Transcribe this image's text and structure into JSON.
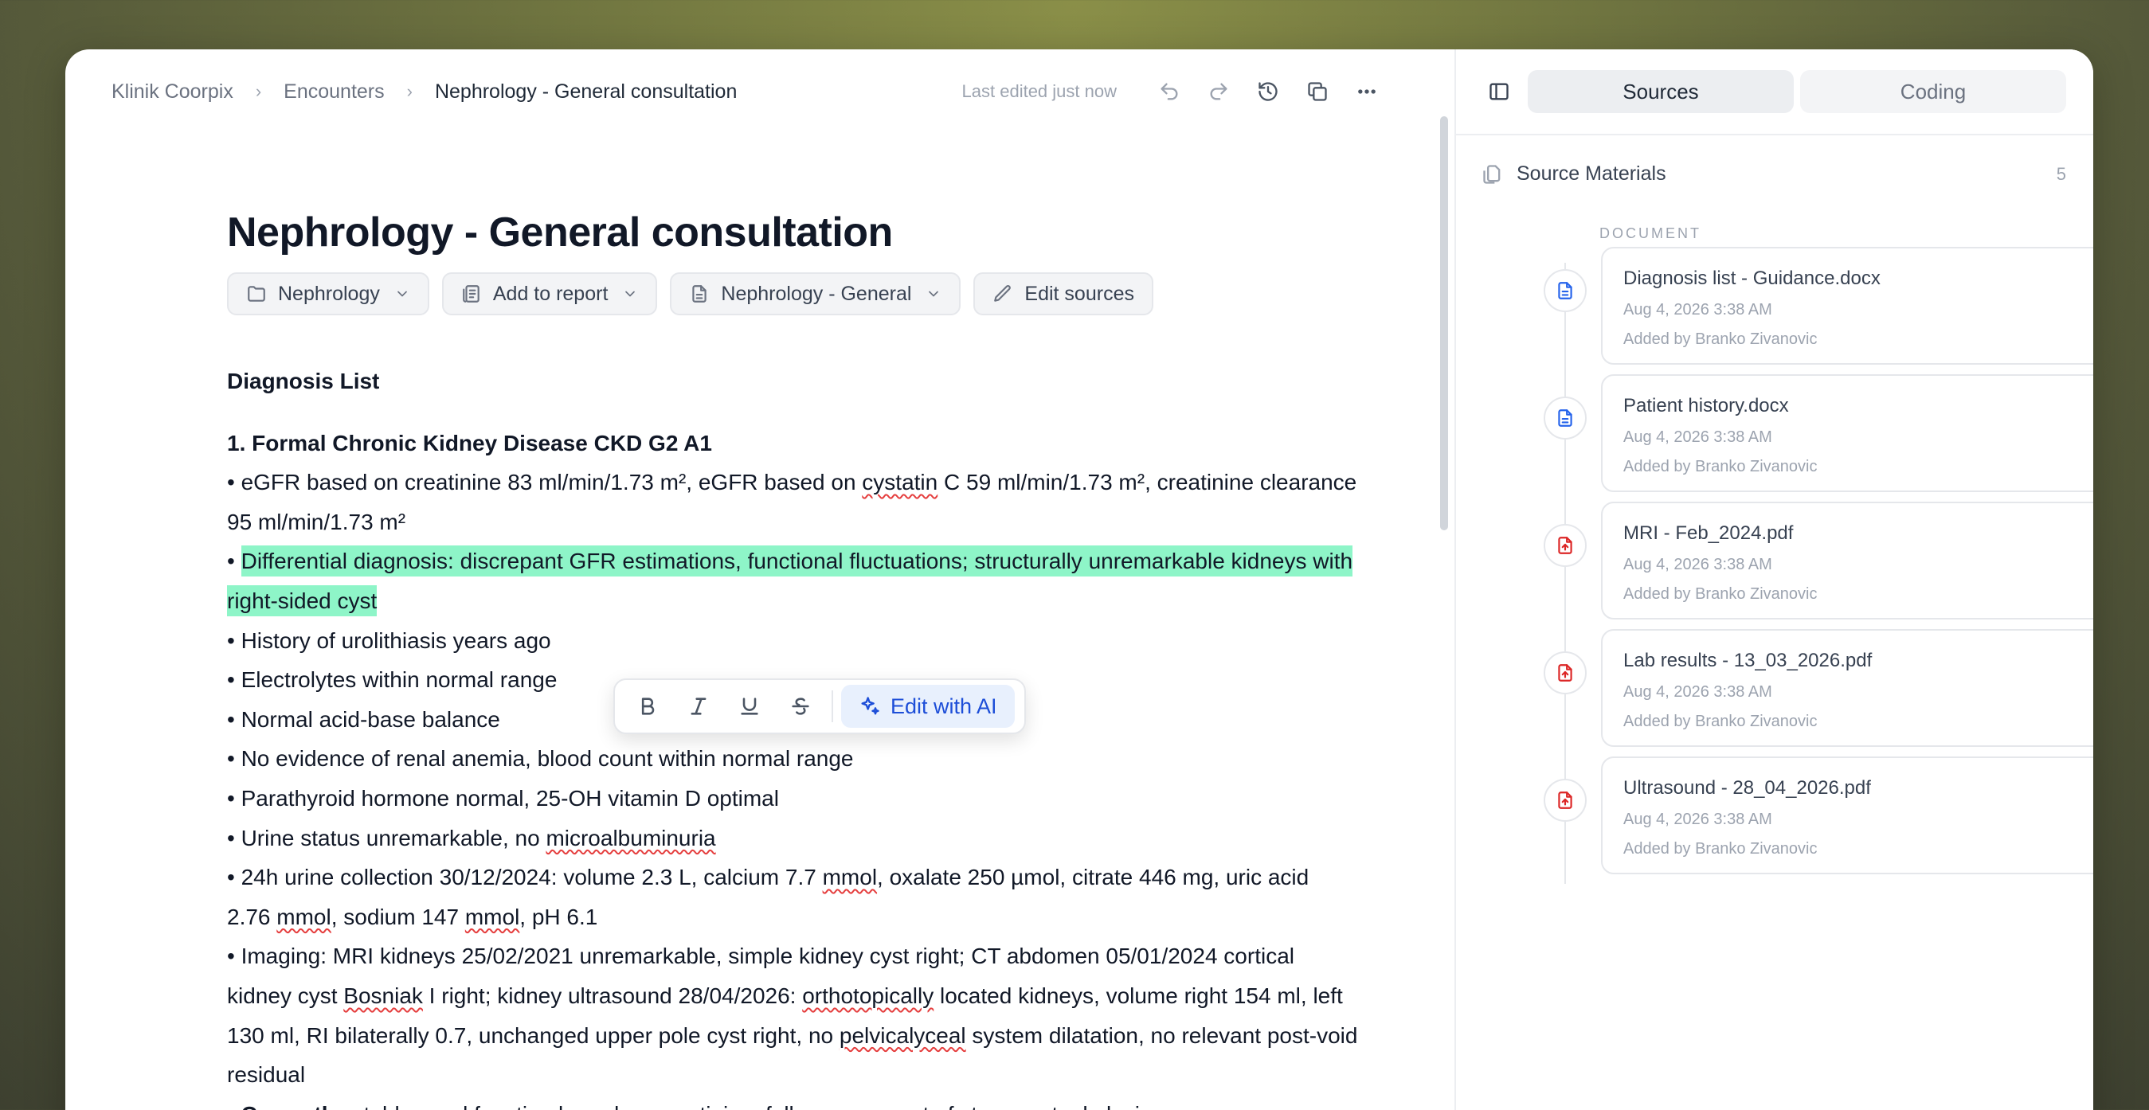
{
  "breadcrumb": [
    "Klinik Coorpix",
    "Encounters",
    "Nephrology - General consultation"
  ],
  "status": {
    "last_edited": "Last edited just now"
  },
  "document": {
    "title": "Nephrology - General consultation",
    "chips": [
      {
        "label": "Nephrology",
        "icon": "folder-icon"
      },
      {
        "label": "Add to report",
        "icon": "report-icon"
      },
      {
        "label": "Nephrology - General",
        "icon": "template-icon"
      },
      {
        "label": "Edit sources",
        "icon": "pencil-icon"
      }
    ],
    "section_title": "Diagnosis List",
    "item_title": "1. Formal Chronic Kidney Disease CKD G2 A1",
    "lines": {
      "l1a": "• eGFR based on creatinine 83 ml/min/1.73 m², eGFR based on ",
      "l1b": "cystatin",
      "l1c": " C 59 ml/min/1.73 m², creatinine clearance 95 ml/min/1.73 m²",
      "l2a": "• ",
      "l2b": "Differential diagnosis: discrepant GFR estimations, functional fluctuations; structurally unremarkable kidneys with right-sided cyst",
      "l3": "• History of urolithiasis years ago",
      "l4": "• Electrolytes within normal range",
      "l5": "• Normal acid-base balance",
      "l6": "• No evidence of renal anemia, blood count within normal range",
      "l7": "• Parathyroid hormone normal, 25-OH vitamin D optimal",
      "l8a": "• Urine status unremarkable, no ",
      "l8b": "microalbuminuria",
      "l9a": "• 24h urine collection 30/12/2024: volume 2.3 L, calcium 7.7 ",
      "l9b": "mmol",
      "l9c": ", oxalate 250 µmol, citrate 446 mg, uric acid 2.76 ",
      "l9d": "mmol",
      "l9e": ", sodium 147 ",
      "l9f": "mmol",
      "l9g": ", pH 6.1",
      "l10a": "• Imaging: MRI kidneys 25/02/2021 unremarkable, simple kidney cyst right; CT abdomen 05/01/2024 cortical kidney cyst ",
      "l10b": "Bosniak",
      "l10c": " I right; kidney ultrasound 28/04/2026: ",
      "l10d": "orthotopically",
      "l10e": " located kidneys, volume right 154 ml, left 130 ml, RI bilaterally 0.7, unchanged upper pole cyst right, no ",
      "l10f": "pelvicalyceal",
      "l10g": " system dilatation, no relevant post-void residual",
      "l11a": "• ",
      "l11b": "Currently",
      "l11c": ": stable renal function based on creatinine, follow-up as part of stone metaphylaxis"
    }
  },
  "format_toolbar": {
    "ai_label": "Edit with AI"
  },
  "sidebar": {
    "tabs": [
      "Sources",
      "Coding"
    ],
    "active_tab": "Sources",
    "heading": "Source Materials",
    "count": "5",
    "group_label": "DOCUMENT",
    "sources": [
      {
        "name": "Diagnosis list - Guidance.docx",
        "date": "Aug 4, 2026 3:38 AM",
        "added_by": "Added by Branko Zivanovic",
        "type": "docx"
      },
      {
        "name": "Patient history.docx",
        "date": "Aug 4, 2026 3:38 AM",
        "added_by": "Added by Branko Zivanovic",
        "type": "docx"
      },
      {
        "name": "MRI - Feb_2024.pdf",
        "date": "Aug 4, 2026 3:38 AM",
        "added_by": "Added by Branko Zivanovic",
        "type": "pdf"
      },
      {
        "name": "Lab results - 13_03_2026.pdf",
        "date": "Aug 4, 2026 3:38 AM",
        "added_by": "Added by Branko Zivanovic",
        "type": "pdf"
      },
      {
        "name": "Ultrasound - 28_04_2026.pdf",
        "date": "Aug 4, 2026 3:38 AM",
        "added_by": "Added by Branko Zivanovic",
        "type": "pdf"
      }
    ]
  },
  "colors": {
    "highlight": "#8ef5c8",
    "accent": "#1d4ed8",
    "pdf": "#dc2626",
    "docx": "#2563eb"
  }
}
